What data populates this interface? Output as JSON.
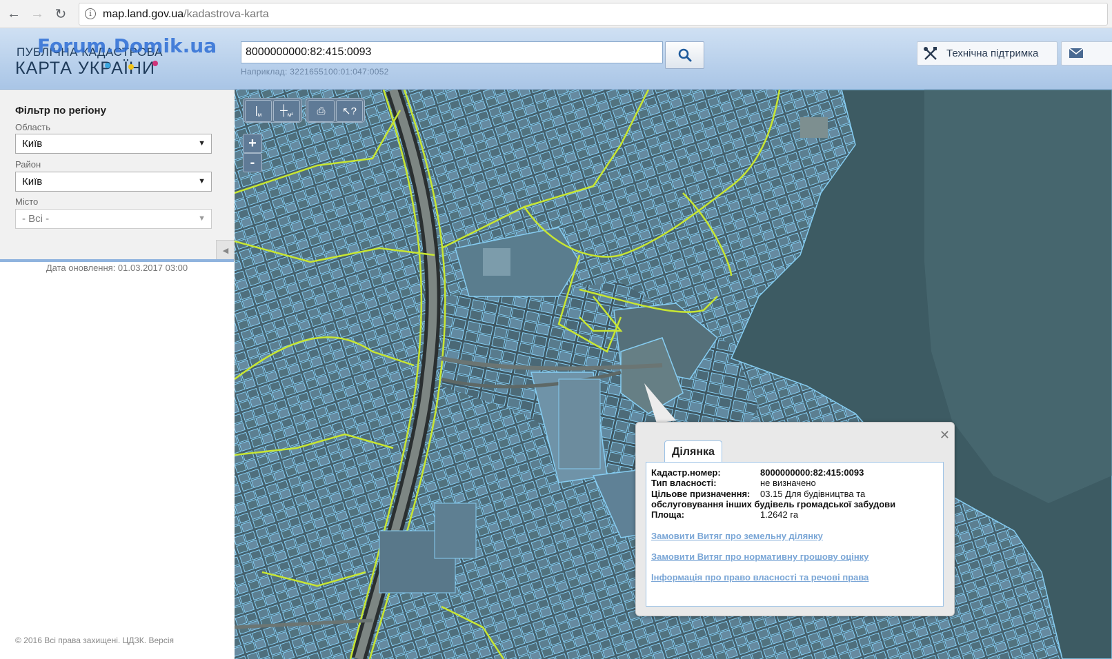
{
  "browser": {
    "url_domain": "map.land.gov.ua",
    "url_path": "/kadastrova-karta"
  },
  "header": {
    "logo_line1": "ПУБЛІЧНА КАДАСТРОВА",
    "logo_line2": "КАРТА УКРАЇНИ",
    "watermark": "Forum.Domik.ua",
    "search_value": "8000000000:82:415:0093",
    "search_hint": "Наприклад: 3221655100:01:047:0052",
    "support_label": "Технічна підтримка"
  },
  "sidebar": {
    "filter_title": "Фільтр по регіону",
    "oblast_label": "Область",
    "oblast_value": "Київ",
    "rayon_label": "Район",
    "rayon_value": "Київ",
    "misto_label": "Місто",
    "misto_value": "- Всі -",
    "update_date": "Дата оновлення: 01.03.2017 03:00",
    "footer": "© 2016 Всі права захищені. ЦДЗК. Версія"
  },
  "map": {
    "zoom_in": "+",
    "zoom_out": "-"
  },
  "popup": {
    "tab_label": "Ділянка",
    "rows": [
      {
        "key": "Кадастр.номер:",
        "value": "8000000000:82:415:0093"
      },
      {
        "key": "Тип власності:",
        "value": "не визначено"
      },
      {
        "key": "Цільове призначення:",
        "value": "03.15 Для будівництва та"
      },
      {
        "key": "",
        "value": "обслуговування інших будівель громадської забудови"
      },
      {
        "key": "Площа:",
        "value": "1.2642 га"
      }
    ],
    "links": [
      "Замовити Витяг про земельну ділянку",
      "Замовити Витяг про нормативну грошову оцінку",
      "Інформація про право власності та речові права"
    ]
  },
  "colors": {
    "parcel_outline": "#7fc6f0",
    "boundary": "#c8e632",
    "header_bg": "#b9d0ec",
    "link": "#7aa6d6"
  }
}
